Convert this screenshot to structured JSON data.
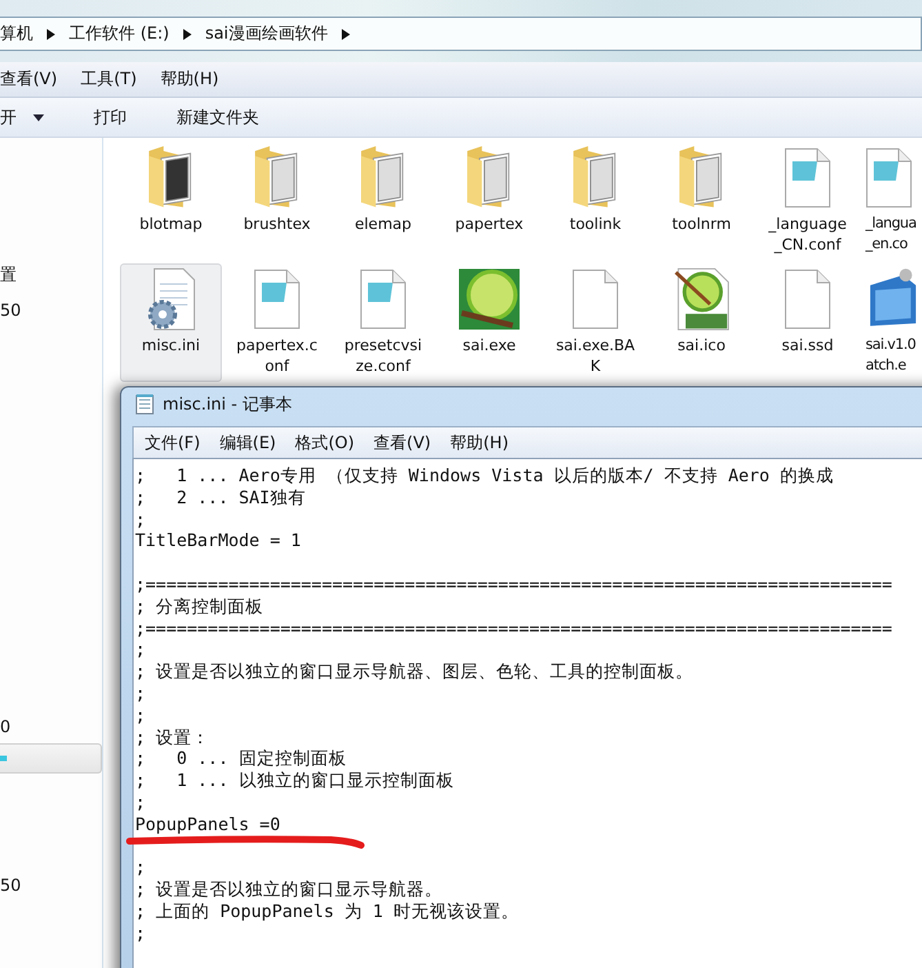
{
  "address_bar": {
    "crumbs": [
      "算机",
      "工作软件 (E:)",
      "sai漫画绘画软件"
    ]
  },
  "menu_bar": [
    "查看(V)",
    "工具(T)",
    "帮助(H)"
  ],
  "toolbar": [
    {
      "label": "开",
      "dropdown": true
    },
    {
      "label": "打印",
      "dropdown": false
    },
    {
      "label": "新建文件夹",
      "dropdown": false
    }
  ],
  "sidebar": {
    "items": [
      {
        "text": "置",
        "selected": false
      },
      {
        "text": "50",
        "selected": false
      },
      {
        "text": "0",
        "selected": false
      },
      {
        "selected": true
      },
      {
        "text": "50",
        "selected": false
      }
    ]
  },
  "files": [
    {
      "kind": "folder",
      "label": [
        "blotmap"
      ],
      "selected": false
    },
    {
      "kind": "folder",
      "label": [
        "brushtex"
      ],
      "selected": false
    },
    {
      "kind": "folder",
      "label": [
        "elemap"
      ],
      "selected": false
    },
    {
      "kind": "folder",
      "label": [
        "papertex"
      ],
      "selected": false
    },
    {
      "kind": "folder",
      "label": [
        "toolink"
      ],
      "selected": false
    },
    {
      "kind": "folder",
      "label": [
        "toolnrm"
      ],
      "selected": false
    },
    {
      "kind": "text-doc",
      "label": [
        "_language",
        "_CN.conf"
      ],
      "selected": false
    },
    {
      "kind": "text-doc",
      "label": [
        "_langua",
        "_en.co"
      ],
      "selected": false
    },
    {
      "kind": "settings-doc",
      "label": [
        "misc.ini"
      ],
      "selected": true
    },
    {
      "kind": "text-doc",
      "label": [
        "papertex.c",
        "onf"
      ],
      "selected": false
    },
    {
      "kind": "text-doc",
      "label": [
        "presetcvsi",
        "ze.conf"
      ],
      "selected": false
    },
    {
      "kind": "app",
      "label": [
        "sai.exe"
      ],
      "selected": false
    },
    {
      "kind": "blank-doc",
      "label": [
        "sai.exe.BA",
        "K"
      ],
      "selected": false
    },
    {
      "kind": "sai-icon",
      "label": [
        "sai.ico"
      ],
      "selected": false
    },
    {
      "kind": "blank-doc",
      "label": [
        "sai.ssd"
      ],
      "selected": false
    },
    {
      "kind": "installer",
      "label": [
        "sai.v1.0",
        "atch.e"
      ],
      "selected": false
    }
  ],
  "notepad": {
    "title": "misc.ini - 记事本",
    "menu": [
      "文件(F)",
      "编辑(E)",
      "格式(O)",
      "查看(V)",
      "帮助(H)"
    ],
    "lines": [
      {
        "kind": "text",
        "text": ";   1 ... Aero专用 （仅支持 Windows Vista 以后的版本/ 不支持 Aero 的换成"
      },
      {
        "kind": "text",
        "text": ";   2 ... SAI独有"
      },
      {
        "kind": "text",
        "text": ";"
      },
      {
        "kind": "text",
        "text": "TitleBarMode = 1"
      },
      {
        "kind": "blank"
      },
      {
        "kind": "text",
        "text": ";========================================================================"
      },
      {
        "kind": "text",
        "text": "; 分离控制面板"
      },
      {
        "kind": "text",
        "text": ";========================================================================"
      },
      {
        "kind": "text",
        "text": ";"
      },
      {
        "kind": "text",
        "text": "; 设置是否以独立的窗口显示导航器、图层、色轮、工具的控制面板。"
      },
      {
        "kind": "text",
        "text": ";"
      },
      {
        "kind": "text",
        "text": ";"
      },
      {
        "kind": "text",
        "text": "; 设置："
      },
      {
        "kind": "text",
        "text": ";   0 ... 固定控制面板"
      },
      {
        "kind": "text",
        "text": ";   1 ... 以独立的窗口显示控制面板"
      },
      {
        "kind": "text",
        "text": ";"
      },
      {
        "kind": "text",
        "text": "PopupPanels =0"
      },
      {
        "kind": "mark"
      },
      {
        "kind": "text",
        "text": ";"
      },
      {
        "kind": "text",
        "text": "; 设置是否以独立的窗口显示导航器。"
      },
      {
        "kind": "text",
        "text": "; 上面的 PopupPanels 为 1 时无视该设置。"
      },
      {
        "kind": "text",
        "text": ";"
      }
    ]
  }
}
